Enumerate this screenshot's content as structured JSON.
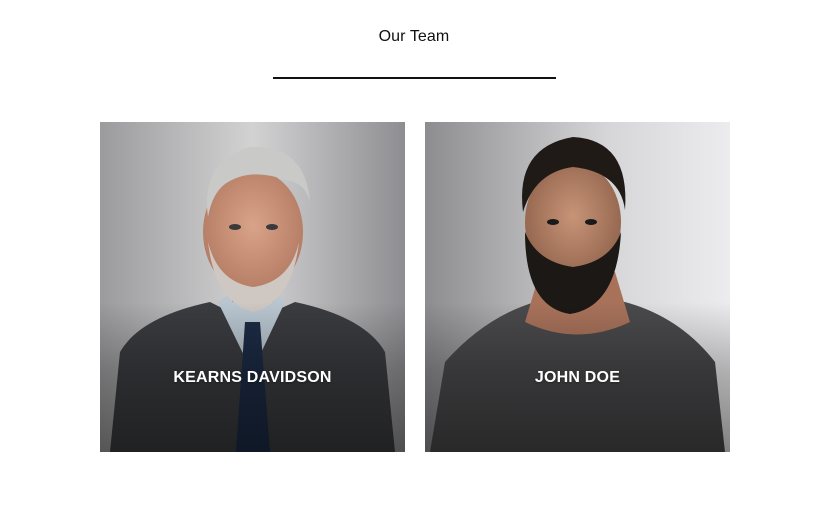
{
  "section": {
    "title": "Our Team"
  },
  "team": [
    {
      "name": "KEARNS DAVIDSON",
      "photo": "portrait-photo-gray-haired-man-in-suit"
    },
    {
      "name": "JOHN DOE",
      "photo": "portrait-photo-bearded-man-in-tshirt"
    }
  ],
  "colors": {
    "background": "#ffffff",
    "title": "#111111",
    "divider": "#111111",
    "name_text": "#ffffff"
  }
}
